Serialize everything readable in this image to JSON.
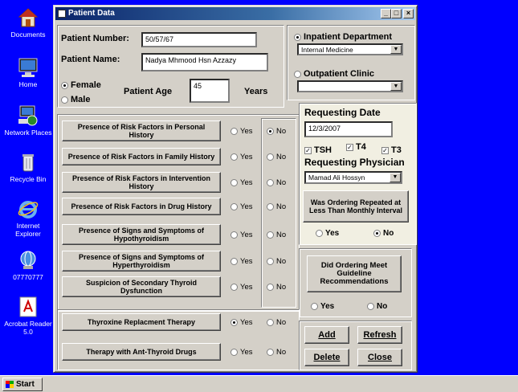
{
  "desktop": {
    "icons": [
      {
        "label": "Documents"
      },
      {
        "label": "Home"
      },
      {
        "label": "Network Places"
      },
      {
        "label": "Recycle Bin"
      },
      {
        "label": "Internet Explorer"
      },
      {
        "label": "07770777"
      },
      {
        "label": "Acrobat Reader 5.0"
      }
    ]
  },
  "taskbar": {
    "start_label": "Start"
  },
  "window": {
    "title": "Patient Data",
    "controls": {
      "minimize": "_",
      "maximize": "□",
      "close": "×"
    }
  },
  "patient": {
    "number_label": "Patient Number:",
    "number_value": "50/57/67",
    "name_label": "Patient Name:",
    "name_value": "Nadya Mhmood Hsn Azzazy",
    "female_label": "Female",
    "male_label": "Male",
    "gender_selected": "female",
    "age_label": "Patient Age",
    "age_value": "45",
    "years_label": "Years"
  },
  "department": {
    "inpatient_label": "Inpatient Department",
    "inpatient_value": "Internal Medicine",
    "outpatient_label": "Outpatient Clinic",
    "outpatient_value": "",
    "selected": "inpatient"
  },
  "risk_factors": {
    "yes_label": "Yes",
    "no_label": "No",
    "rows": [
      {
        "label": "Presence of Risk Factors in Personal History",
        "selected": "no"
      },
      {
        "label": "Presence of Risk Factors in Family History",
        "selected": "none"
      },
      {
        "label": "Presence of Risk Factors in Intervention History",
        "selected": "none"
      },
      {
        "label": "Presence of Risk Factors in Drug History",
        "selected": "none"
      },
      {
        "label": "Presence of Signs and Symptoms of Hypothyroidism",
        "selected": "none"
      },
      {
        "label": "Presence of Signs and Symptoms of Hyperthyroidism",
        "selected": "none"
      },
      {
        "label": "Suspicion of Secondary Thyroid Dysfunction",
        "selected": "none"
      }
    ]
  },
  "therapy": {
    "rows": [
      {
        "label": "Thyroxine Replacment Therapy",
        "selected": "yes"
      },
      {
        "label": "Therapy  with Ant-Thyroid Drugs",
        "selected": "none"
      }
    ]
  },
  "request": {
    "date_label": "Requesting Date",
    "date_value": "12/3/2007",
    "tsh_label": "TSH",
    "t4_label": "T4",
    "t3_label": "T3",
    "check_mark": "✓",
    "physician_label": "Requesting Physician",
    "physician_value": "Mamad Ali Hossyn",
    "repeat_button": "Was Ordering Repeated at Less Than Monthly Interval",
    "repeat_selected": "no"
  },
  "guideline": {
    "button": "Did Ordering Meet Guideline Recommendations",
    "selected": "none"
  },
  "actions": {
    "add": "Add",
    "refresh": "Refresh",
    "delete": "Delete",
    "close": "Close"
  }
}
